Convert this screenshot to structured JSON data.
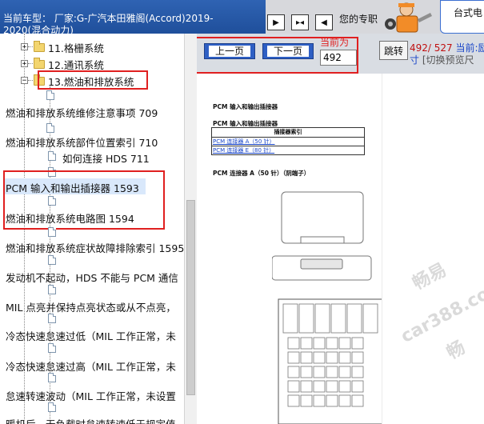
{
  "header": {
    "vehicle_line1": "当前车型：  厂家:G-广汽本田雅阁(Accord)2019-",
    "vehicle_line2": "2020(混合动力)",
    "promo_text": "您的专职",
    "promo_card_text": "台式电"
  },
  "tree": {
    "folders": [
      {
        "label": "11.格栅系统",
        "expander": "+"
      },
      {
        "label": "12.通讯系统",
        "expander": "+"
      },
      {
        "label": "13.燃油和排放系统",
        "expander": "−"
      }
    ],
    "items": [
      {
        "label": "燃油和排放系统维修注意事项 709"
      },
      {
        "label": "燃油和排放系统部件位置索引 710"
      },
      {
        "label": "如何连接 HDS 711"
      },
      {
        "label": "PCM 输入和输出插接器 1593"
      },
      {
        "label": "燃油和排放系统电路图 1594"
      },
      {
        "label": "燃油和排放系统症状故障排除索引 1595"
      },
      {
        "label": "发动机不起动，HDS 不能与 PCM 通信"
      },
      {
        "label": "MIL 点亮并保持点亮状态或从不点亮，"
      },
      {
        "label": "冷态快速怠速过低（MIL 工作正常，未"
      },
      {
        "label": "冷态快速怠速过高（MIL 工作正常，未"
      },
      {
        "label": "怠速转速波动（MIL 工作正常，未设置"
      },
      {
        "label": "暖机后，无负载时怠速转速低于规定值"
      }
    ]
  },
  "pager": {
    "prev_label": "上一页",
    "next_label": "下一页",
    "current_label": "当前为",
    "current_page": "492",
    "jump_label": "跳转",
    "page_count": "492/ 527",
    "current_suffix": "当前:",
    "current_suffix_tail": "励",
    "extra_char": "寸",
    "preview_toggle": "[切换预览尺"
  },
  "document": {
    "title1": "PCM 输入和输出插接器",
    "title2": "PCM 输入和输出插接器",
    "table_header": "插接器索引",
    "links": [
      "PCM 连接器 A（50 针）",
      "PCM 连接器 E（80 针）"
    ],
    "connector_title": "PCM 连接器 A（50 针）（阴端子）",
    "watermark1": "畅易",
    "watermark2": "car388.co",
    "watermark3": "畅"
  },
  "colors": {
    "header_blue": "#2f63b3",
    "pager_button_blue": "#2e5fc4",
    "highlight_red": "#e02020",
    "link_blue": "#1a46c8"
  }
}
